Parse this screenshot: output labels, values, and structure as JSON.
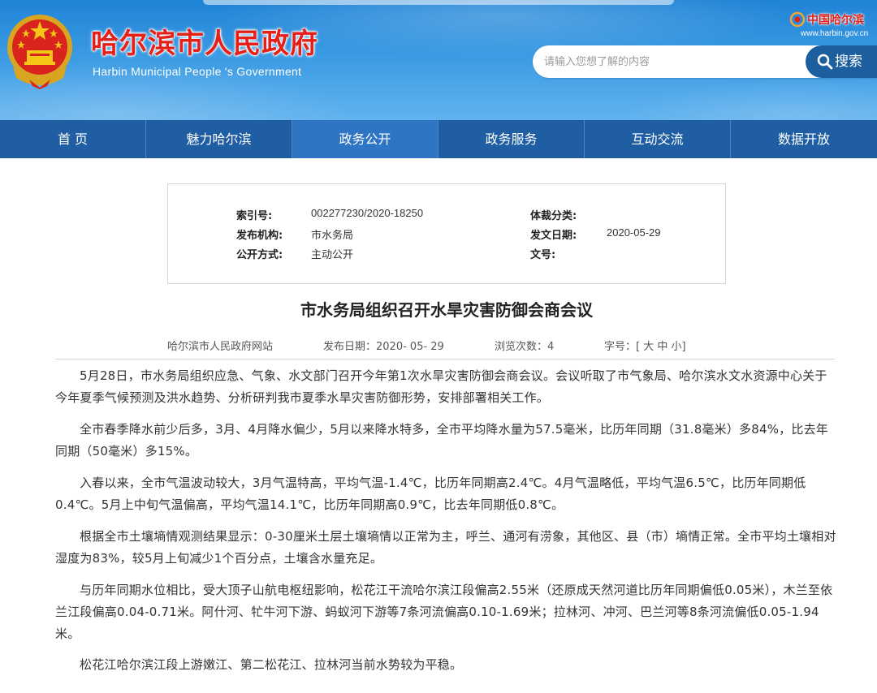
{
  "header": {
    "site_title": "哈尔滨市人民政府",
    "site_subtitle": "Harbin Municipal People 's Government",
    "brand_name": "中国哈尔滨",
    "brand_url": "www.harbin.gov.cn",
    "search_placeholder": "请输入您想了解的内容",
    "search_button": "搜索"
  },
  "nav": {
    "items": [
      "首 页",
      "魅力哈尔滨",
      "政务公开",
      "政务服务",
      "互动交流",
      "数据开放"
    ],
    "active_index": 2
  },
  "info": {
    "index_label": "索引号:",
    "index_value": "002277230/2020-18250",
    "category_label": "体裁分类:",
    "category_value": "",
    "issuer_label": "发布机构:",
    "issuer_value": "市水务局",
    "date_label": "发文日期:",
    "date_value": "2020-05-29",
    "mode_label": "公开方式:",
    "mode_value": "主动公开",
    "docno_label": "文号:",
    "docno_value": ""
  },
  "article": {
    "title": "市水务局组织召开水旱灾害防御会商会议",
    "source": "哈尔滨市人民政府网站",
    "publish_label": "发布日期：",
    "publish_date": "2020- 05- 29",
    "views_label": "浏览次数：",
    "views": "4",
    "fontsize_label": "字号：[ 大 中 小]",
    "paragraphs": [
      "5月28日，市水务局组织应急、气象、水文部门召开今年第1次水旱灾害防御会商会议。会议听取了市气象局、哈尔滨水文水资源中心关于今年夏季气候预测及洪水趋势、分析研判我市夏季水旱灾害防御形势，安排部署相关工作。",
      "全市春季降水前少后多，3月、4月降水偏少，5月以来降水特多，全市平均降水量为57.5毫米，比历年同期（31.8毫米）多84%，比去年同期（50毫米）多15%。",
      "入春以来，全市气温波动较大，3月气温特高，平均气温-1.4℃，比历年同期高2.4℃。4月气温略低，平均气温6.5℃，比历年同期低0.4℃。5月上中旬气温偏高，平均气温14.1℃，比历年同期高0.9℃，比去年同期低0.8℃。",
      "根据全市土壤墒情观测结果显示：0-30厘米土层土壤墒情以正常为主，呼兰、通河有涝象，其他区、县（市）墒情正常。全市平均土壤相对湿度为83%，较5月上旬减少1个百分点，土壤含水量充足。",
      "与历年同期水位相比，受大顶子山航电枢纽影响，松花江干流哈尔滨江段偏高2.55米（还原成天然河道比历年同期偏低0.05米），木兰至依兰江段偏高0.04-0.71米。阿什河、牤牛河下游、蚂蚁河下游等7条河流偏高0.10-1.69米；拉林河、冲河、巴兰河等8条河流偏低0.05-1.94米。",
      "松花江哈尔滨江段上游嫩江、第二松花江、拉林河当前水势较为平稳。"
    ]
  },
  "colors": {
    "nav_bg": "#1f5ea3",
    "nav_active": "#2e76c4",
    "title_red": "#e52018",
    "search_button": "#1d5e9e"
  }
}
